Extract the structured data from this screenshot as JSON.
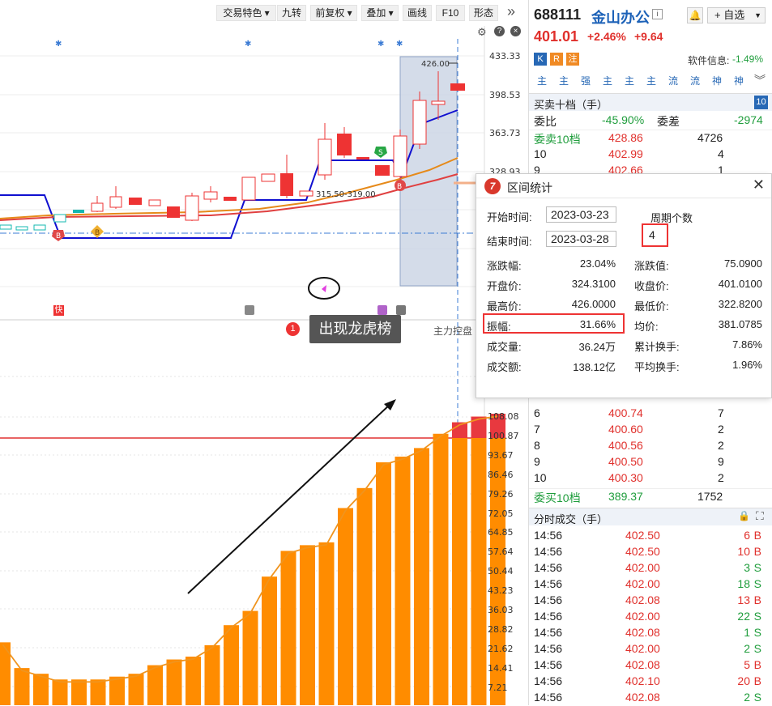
{
  "toolbar": {
    "buttons": [
      "交易特色 ▾",
      "九转",
      "前复权 ▾",
      "叠加 ▾",
      "画线",
      "F10",
      "形态"
    ],
    "more": "»"
  },
  "price_axis": [
    "433.33",
    "398.53",
    "363.73",
    "328.93"
  ],
  "volume_axis": [
    "108.08",
    "100.87",
    "93.67",
    "86.46",
    "79.26",
    "72.05",
    "64.85",
    "57.64",
    "50.44",
    "43.23",
    "36.03",
    "28.82",
    "21.62",
    "14.41",
    "7.21"
  ],
  "chart": {
    "high_label": "426.00",
    "range_label": "315.50-319.00",
    "markers": {
      "buy": "B",
      "sell": "S"
    },
    "tags": {
      "kuai": "快"
    },
    "event_badge": "1",
    "event_text": "出现龙虎榜",
    "main_control": "主力控盘"
  },
  "chart_data": {
    "type": "bar",
    "values": [
      22,
      13,
      11,
      9,
      9,
      9,
      10,
      11,
      14,
      16,
      17,
      21,
      28,
      33,
      45,
      54,
      56,
      57,
      69,
      76,
      85,
      87,
      90,
      95,
      99,
      101,
      102
    ]
  },
  "stock": {
    "code": "688111",
    "name": "金山办公",
    "price": "401.01",
    "change_pct": "+2.46%",
    "change": "+9.64",
    "watch_label": "自选",
    "tags": [
      "K",
      "R",
      "注"
    ],
    "software_info_label": "软件信息:",
    "software_info_value": "-1.49%",
    "buttons": [
      "主",
      "主",
      "强",
      "主",
      "主",
      "主",
      "流",
      "流",
      "神",
      "神"
    ]
  },
  "orderbook": {
    "title": "买卖十档（手）",
    "count": "10",
    "wei_bi_label": "委比",
    "wei_bi": "-45.90%",
    "wei_cha_label": "委差",
    "wei_cha": "-2974",
    "sell10_label": "委卖10档",
    "sell10_price": "428.86",
    "sell10_vol": "4726",
    "asks": [
      {
        "lvl": "10",
        "price": "402.99",
        "vol": "4"
      },
      {
        "lvl": "9",
        "price": "402.66",
        "vol": "1"
      }
    ],
    "bids": [
      {
        "lvl": "6",
        "price": "400.74",
        "vol": "7"
      },
      {
        "lvl": "7",
        "price": "400.60",
        "vol": "2"
      },
      {
        "lvl": "8",
        "price": "400.56",
        "vol": "2"
      },
      {
        "lvl": "9",
        "price": "400.50",
        "vol": "9"
      },
      {
        "lvl": "10",
        "price": "400.30",
        "vol": "2"
      }
    ],
    "buy10_label": "委买10档",
    "buy10_price": "389.37",
    "buy10_vol": "1752"
  },
  "ticks": {
    "title": "分时成交（手）",
    "rows": [
      {
        "t": "14:56",
        "p": "402.50",
        "v": "6",
        "s": "B"
      },
      {
        "t": "14:56",
        "p": "402.50",
        "v": "10",
        "s": "B"
      },
      {
        "t": "14:56",
        "p": "402.00",
        "v": "3",
        "s": "S"
      },
      {
        "t": "14:56",
        "p": "402.00",
        "v": "18",
        "s": "S"
      },
      {
        "t": "14:56",
        "p": "402.08",
        "v": "13",
        "s": "B"
      },
      {
        "t": "14:56",
        "p": "402.00",
        "v": "22",
        "s": "S"
      },
      {
        "t": "14:56",
        "p": "402.08",
        "v": "1",
        "s": "S"
      },
      {
        "t": "14:56",
        "p": "402.00",
        "v": "2",
        "s": "S"
      },
      {
        "t": "14:56",
        "p": "402.08",
        "v": "5",
        "s": "B"
      },
      {
        "t": "14:56",
        "p": "402.10",
        "v": "20",
        "s": "B"
      },
      {
        "t": "14:56",
        "p": "402.08",
        "v": "2",
        "s": "S"
      }
    ]
  },
  "popup": {
    "title": "区间统计",
    "start_label": "开始时间:",
    "start_value": "2023-03-23",
    "end_label": "结束时间:",
    "end_value": "2023-03-28",
    "period_label": "周期个数",
    "period_value": "4",
    "stats": [
      {
        "l1": "涨跌幅:",
        "v1": "23.04%",
        "l2": "涨跌值:",
        "v2": "75.0900"
      },
      {
        "l1": "开盘价:",
        "v1": "324.3100",
        "l2": "收盘价:",
        "v2": "401.0100"
      },
      {
        "l1": "最高价:",
        "v1": "426.0000",
        "l2": "最低价:",
        "v2": "322.8200"
      },
      {
        "l1": "振幅:",
        "v1": "31.66%",
        "l2": "均价:",
        "v2": "381.0785"
      },
      {
        "l1": "成交量:",
        "v1": "36.24万",
        "l2": "累计换手:",
        "v2": "7.86%"
      },
      {
        "l1": "成交额:",
        "v1": "138.12亿",
        "l2": "平均换手:",
        "v2": "1.96%"
      }
    ]
  }
}
